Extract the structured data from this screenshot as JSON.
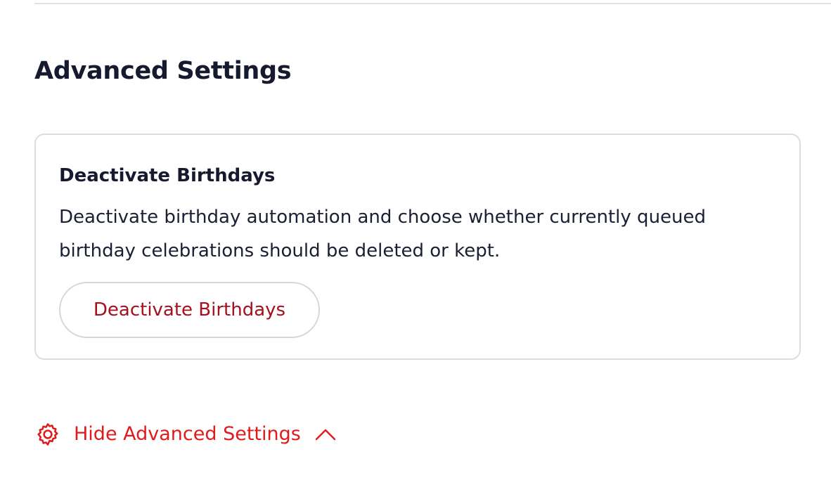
{
  "section": {
    "title": "Advanced Settings"
  },
  "card": {
    "title": "Deactivate Birthdays",
    "description": "Deactivate birthday automation and choose whether currently queued birthday celebrations should be deleted or kept.",
    "button_label": "Deactivate Birthdays"
  },
  "toggle": {
    "label": "Hide Advanced Settings",
    "icon": "gear-icon",
    "chevron": "chevron-up-icon"
  },
  "colors": {
    "accent": "#e01b1b",
    "danger_text": "#a4111d",
    "heading": "#151a2e",
    "border": "#dcdce1"
  }
}
